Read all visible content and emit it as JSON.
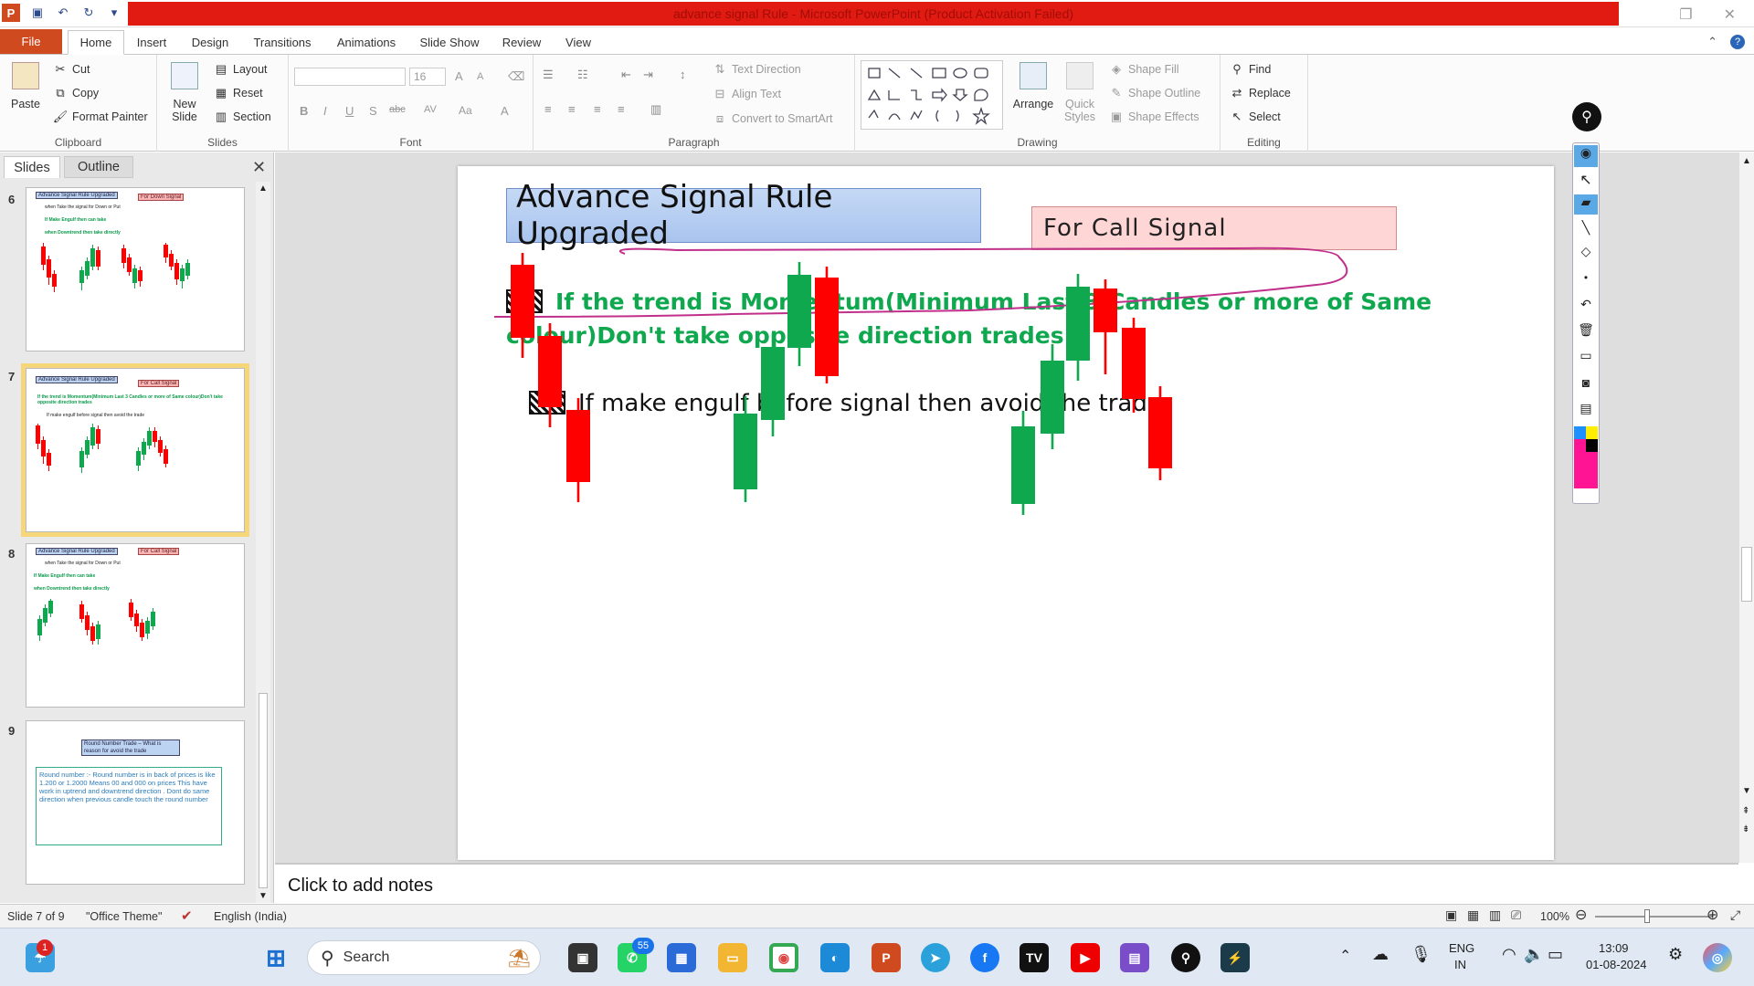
{
  "window": {
    "title": "advance signal Rule - Microsoft PowerPoint (Product Activation Failed)"
  },
  "tabs": {
    "file": "File",
    "items": [
      "Home",
      "Insert",
      "Design",
      "Transitions",
      "Animations",
      "Slide Show",
      "Review",
      "View"
    ]
  },
  "ribbon": {
    "clipboard": {
      "label": "Clipboard",
      "paste": "Paste",
      "cut": "Cut",
      "copy": "Copy",
      "format_painter": "Format Painter"
    },
    "slides": {
      "label": "Slides",
      "new_slide": "New Slide",
      "layout": "Layout",
      "reset": "Reset",
      "section": "Section"
    },
    "font": {
      "label": "Font",
      "size": "16"
    },
    "paragraph": {
      "label": "Paragraph",
      "text_direction": "Text Direction",
      "align_text": "Align Text",
      "convert": "Convert to SmartArt"
    },
    "drawing": {
      "label": "Drawing",
      "arrange": "Arrange",
      "quick_styles": "Quick Styles",
      "shape_fill": "Shape Fill",
      "shape_outline": "Shape Outline",
      "shape_effects": "Shape Effects"
    },
    "editing": {
      "label": "Editing",
      "find": "Find",
      "replace": "Replace",
      "select": "Select"
    }
  },
  "left_pane": {
    "tab_slides": "Slides",
    "tab_outline": "Outline",
    "thumbs": [
      {
        "num": "6",
        "title": "Advance Signal Rule Upgraded",
        "tag": "For Down Signal",
        "lines": [
          "when Take the signal for Down or Put",
          "If Make Engulf then can take",
          "when Downtrend then take directly"
        ]
      },
      {
        "num": "7",
        "title": "Advance Signal Rule Upgraded",
        "tag": "For Call Signal",
        "lines": [
          "If the trend is Momentum(Minimum Last 3 Candles or more of Same colour)Don't take opposite direction trades",
          "If make engulf before signal then avoid the trade"
        ]
      },
      {
        "num": "8",
        "title": "Advance Signal Rule Upgraded",
        "tag": "For Call Signal",
        "lines": [
          "when Take the signal for Down or Put",
          "If Make Engulf then can take",
          "when Downtrend then take directly"
        ]
      },
      {
        "num": "9",
        "title": "Round Number Trade – What is reason for avoid the trade",
        "body": "Round number :- Round number is in back of prices is like 1.200 or 1.2000 Means 00 and 000 on prices This have work in uptrend and downtrend direction . Dont do same direction when previous candle touch the round number"
      }
    ]
  },
  "slide": {
    "title": "Advance Signal Rule Upgraded",
    "subtitle": "For Call  Signal",
    "rule1": "If  the trend is Momentum(Minimum  Last 3 Candles or more of Same colour)Don't take opposite direction trades",
    "rule2": "If make engulf before  signal then avoid the trade",
    "colors": {
      "bull": "#10a84f",
      "bear": "#ff0000",
      "ink": "#c0308a"
    }
  },
  "notes": {
    "placeholder": "Click to add notes"
  },
  "status": {
    "slide": "Slide 7 of 9",
    "theme": "\"Office Theme\"",
    "language": "English (India)",
    "zoom": "100%"
  },
  "taskbar": {
    "search": "Search",
    "badge_whatsapp": "55",
    "lang1": "ENG",
    "lang2": "IN",
    "time": "13:09",
    "date": "01-08-2024"
  }
}
